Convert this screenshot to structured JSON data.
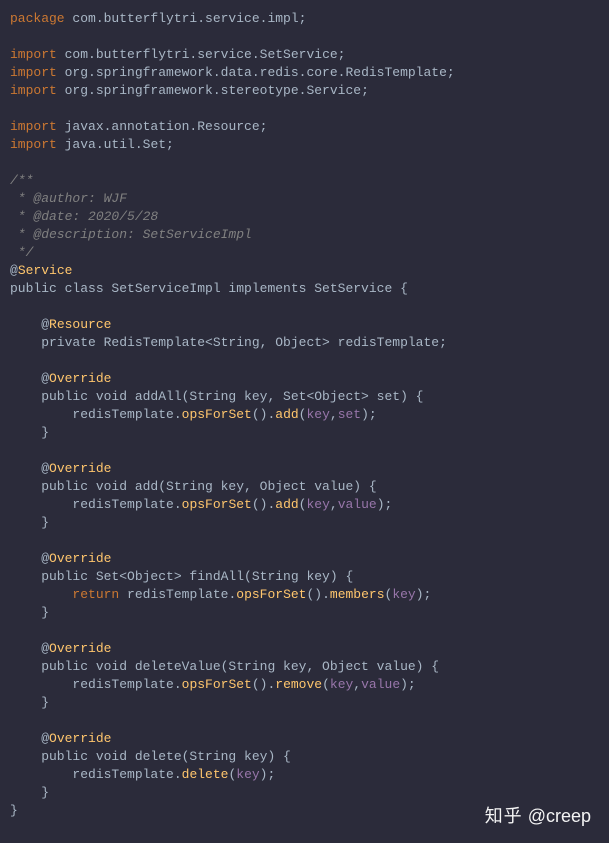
{
  "code": {
    "L01_kw": "package",
    "L01_ns": " com.butterflytri.service.impl",
    "L01_end": ";",
    "L03_kw": "import",
    "L03_ns": " com.butterflytri.service.",
    "L03_cls": "SetService",
    "L03_end": ";",
    "L04_kw": "import",
    "L04_ns": " org.springframework.data.redis.core.",
    "L04_cls": "RedisTemplate",
    "L04_end": ";",
    "L05_kw": "import",
    "L05_ns": " org.springframework.stereotype.",
    "L05_cls": "Service",
    "L05_end": ";",
    "L07_kw": "import",
    "L07_ns": " javax.annotation.",
    "L07_cls": "Resource",
    "L07_end": ";",
    "L08_kw": "import",
    "L08_ns": " java.util.",
    "L08_cls": "Set",
    "L08_end": ";",
    "C1": "/**",
    "C2": " * @author: WJF",
    "C3": " * @date: 2020/5/28",
    "C4": " * @description: SetServiceImpl",
    "C5": " */",
    "A1_at": "@",
    "A1_name": "Service",
    "CLS": "public class SetServiceImpl implements SetService {",
    "A2_at": "    @",
    "A2_name": "Resource",
    "F1": "    private RedisTemplate<String, Object> redisTemplate;",
    "OV_at": "    @",
    "OV_name": "Override",
    "M1_sig": "    public void addAll(String key, Set<Object> set) {",
    "M1_pre": "        redisTemplate.",
    "M1_op": "opsForSet",
    "M1_lp": "().",
    "M1_m": "add",
    "M1_lp2": "(",
    "M1_a1": "key",
    "M1_comma": ",",
    "M1_a2": "set",
    "M1_end": ");",
    "CLOSE": "    }",
    "M2_sig": "    public void add(String key, Object value) {",
    "M2_pre": "        redisTemplate.",
    "M2_op": "opsForSet",
    "M2_lp": "().",
    "M2_m": "add",
    "M2_lp2": "(",
    "M2_a1": "key",
    "M2_comma": ",",
    "M2_a2": "value",
    "M2_end": ");",
    "M3_sig": "    public Set<Object> findAll(String key) {",
    "M3_pre": "        ",
    "M3_ret": "return",
    "M3_mid": " redisTemplate.",
    "M3_op": "opsForSet",
    "M3_lp": "().",
    "M3_m": "members",
    "M3_lp2": "(",
    "M3_a1": "key",
    "M3_end": ");",
    "M4_sig": "    public void deleteValue(String key, Object value) {",
    "M4_pre": "        redisTemplate.",
    "M4_op": "opsForSet",
    "M4_lp": "().",
    "M4_m": "remove",
    "M4_lp2": "(",
    "M4_a1": "key",
    "M4_comma": ",",
    "M4_a2": "value",
    "M4_end": ");",
    "M5_sig": "    public void delete(String key) {",
    "M5_pre": "        redisTemplate.",
    "M5_m": "delete",
    "M5_lp2": "(",
    "M5_a1": "key",
    "M5_end": ");",
    "END": "}"
  },
  "watermark": {
    "zh": "知乎",
    "handle": " @creep"
  }
}
